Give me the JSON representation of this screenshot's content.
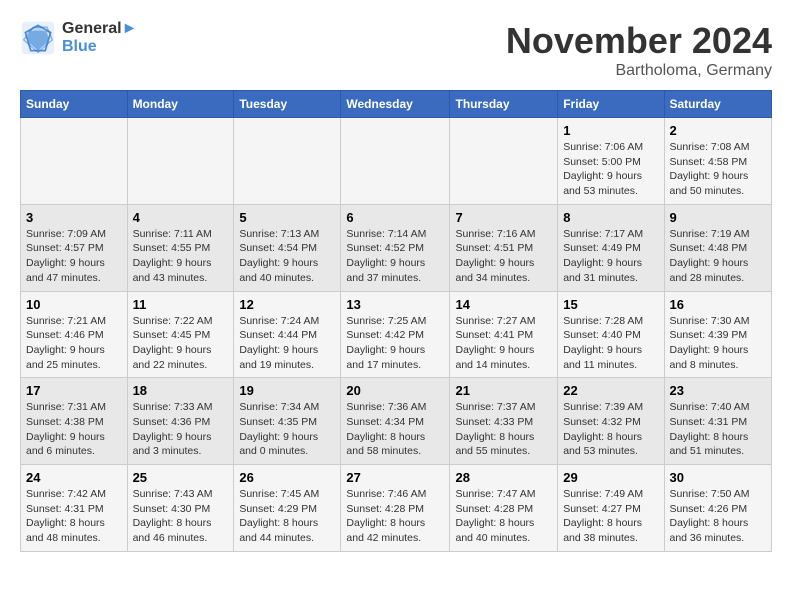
{
  "header": {
    "logo_line1": "General",
    "logo_line2": "Blue",
    "month": "November 2024",
    "location": "Bartholoma, Germany"
  },
  "weekdays": [
    "Sunday",
    "Monday",
    "Tuesday",
    "Wednesday",
    "Thursday",
    "Friday",
    "Saturday"
  ],
  "weeks": [
    [
      {
        "day": "",
        "text": ""
      },
      {
        "day": "",
        "text": ""
      },
      {
        "day": "",
        "text": ""
      },
      {
        "day": "",
        "text": ""
      },
      {
        "day": "",
        "text": ""
      },
      {
        "day": "1",
        "text": "Sunrise: 7:06 AM\nSunset: 5:00 PM\nDaylight: 9 hours and 53 minutes."
      },
      {
        "day": "2",
        "text": "Sunrise: 7:08 AM\nSunset: 4:58 PM\nDaylight: 9 hours and 50 minutes."
      }
    ],
    [
      {
        "day": "3",
        "text": "Sunrise: 7:09 AM\nSunset: 4:57 PM\nDaylight: 9 hours and 47 minutes."
      },
      {
        "day": "4",
        "text": "Sunrise: 7:11 AM\nSunset: 4:55 PM\nDaylight: 9 hours and 43 minutes."
      },
      {
        "day": "5",
        "text": "Sunrise: 7:13 AM\nSunset: 4:54 PM\nDaylight: 9 hours and 40 minutes."
      },
      {
        "day": "6",
        "text": "Sunrise: 7:14 AM\nSunset: 4:52 PM\nDaylight: 9 hours and 37 minutes."
      },
      {
        "day": "7",
        "text": "Sunrise: 7:16 AM\nSunset: 4:51 PM\nDaylight: 9 hours and 34 minutes."
      },
      {
        "day": "8",
        "text": "Sunrise: 7:17 AM\nSunset: 4:49 PM\nDaylight: 9 hours and 31 minutes."
      },
      {
        "day": "9",
        "text": "Sunrise: 7:19 AM\nSunset: 4:48 PM\nDaylight: 9 hours and 28 minutes."
      }
    ],
    [
      {
        "day": "10",
        "text": "Sunrise: 7:21 AM\nSunset: 4:46 PM\nDaylight: 9 hours and 25 minutes."
      },
      {
        "day": "11",
        "text": "Sunrise: 7:22 AM\nSunset: 4:45 PM\nDaylight: 9 hours and 22 minutes."
      },
      {
        "day": "12",
        "text": "Sunrise: 7:24 AM\nSunset: 4:44 PM\nDaylight: 9 hours and 19 minutes."
      },
      {
        "day": "13",
        "text": "Sunrise: 7:25 AM\nSunset: 4:42 PM\nDaylight: 9 hours and 17 minutes."
      },
      {
        "day": "14",
        "text": "Sunrise: 7:27 AM\nSunset: 4:41 PM\nDaylight: 9 hours and 14 minutes."
      },
      {
        "day": "15",
        "text": "Sunrise: 7:28 AM\nSunset: 4:40 PM\nDaylight: 9 hours and 11 minutes."
      },
      {
        "day": "16",
        "text": "Sunrise: 7:30 AM\nSunset: 4:39 PM\nDaylight: 9 hours and 8 minutes."
      }
    ],
    [
      {
        "day": "17",
        "text": "Sunrise: 7:31 AM\nSunset: 4:38 PM\nDaylight: 9 hours and 6 minutes."
      },
      {
        "day": "18",
        "text": "Sunrise: 7:33 AM\nSunset: 4:36 PM\nDaylight: 9 hours and 3 minutes."
      },
      {
        "day": "19",
        "text": "Sunrise: 7:34 AM\nSunset: 4:35 PM\nDaylight: 9 hours and 0 minutes."
      },
      {
        "day": "20",
        "text": "Sunrise: 7:36 AM\nSunset: 4:34 PM\nDaylight: 8 hours and 58 minutes."
      },
      {
        "day": "21",
        "text": "Sunrise: 7:37 AM\nSunset: 4:33 PM\nDaylight: 8 hours and 55 minutes."
      },
      {
        "day": "22",
        "text": "Sunrise: 7:39 AM\nSunset: 4:32 PM\nDaylight: 8 hours and 53 minutes."
      },
      {
        "day": "23",
        "text": "Sunrise: 7:40 AM\nSunset: 4:31 PM\nDaylight: 8 hours and 51 minutes."
      }
    ],
    [
      {
        "day": "24",
        "text": "Sunrise: 7:42 AM\nSunset: 4:31 PM\nDaylight: 8 hours and 48 minutes."
      },
      {
        "day": "25",
        "text": "Sunrise: 7:43 AM\nSunset: 4:30 PM\nDaylight: 8 hours and 46 minutes."
      },
      {
        "day": "26",
        "text": "Sunrise: 7:45 AM\nSunset: 4:29 PM\nDaylight: 8 hours and 44 minutes."
      },
      {
        "day": "27",
        "text": "Sunrise: 7:46 AM\nSunset: 4:28 PM\nDaylight: 8 hours and 42 minutes."
      },
      {
        "day": "28",
        "text": "Sunrise: 7:47 AM\nSunset: 4:28 PM\nDaylight: 8 hours and 40 minutes."
      },
      {
        "day": "29",
        "text": "Sunrise: 7:49 AM\nSunset: 4:27 PM\nDaylight: 8 hours and 38 minutes."
      },
      {
        "day": "30",
        "text": "Sunrise: 7:50 AM\nSunset: 4:26 PM\nDaylight: 8 hours and 36 minutes."
      }
    ]
  ]
}
